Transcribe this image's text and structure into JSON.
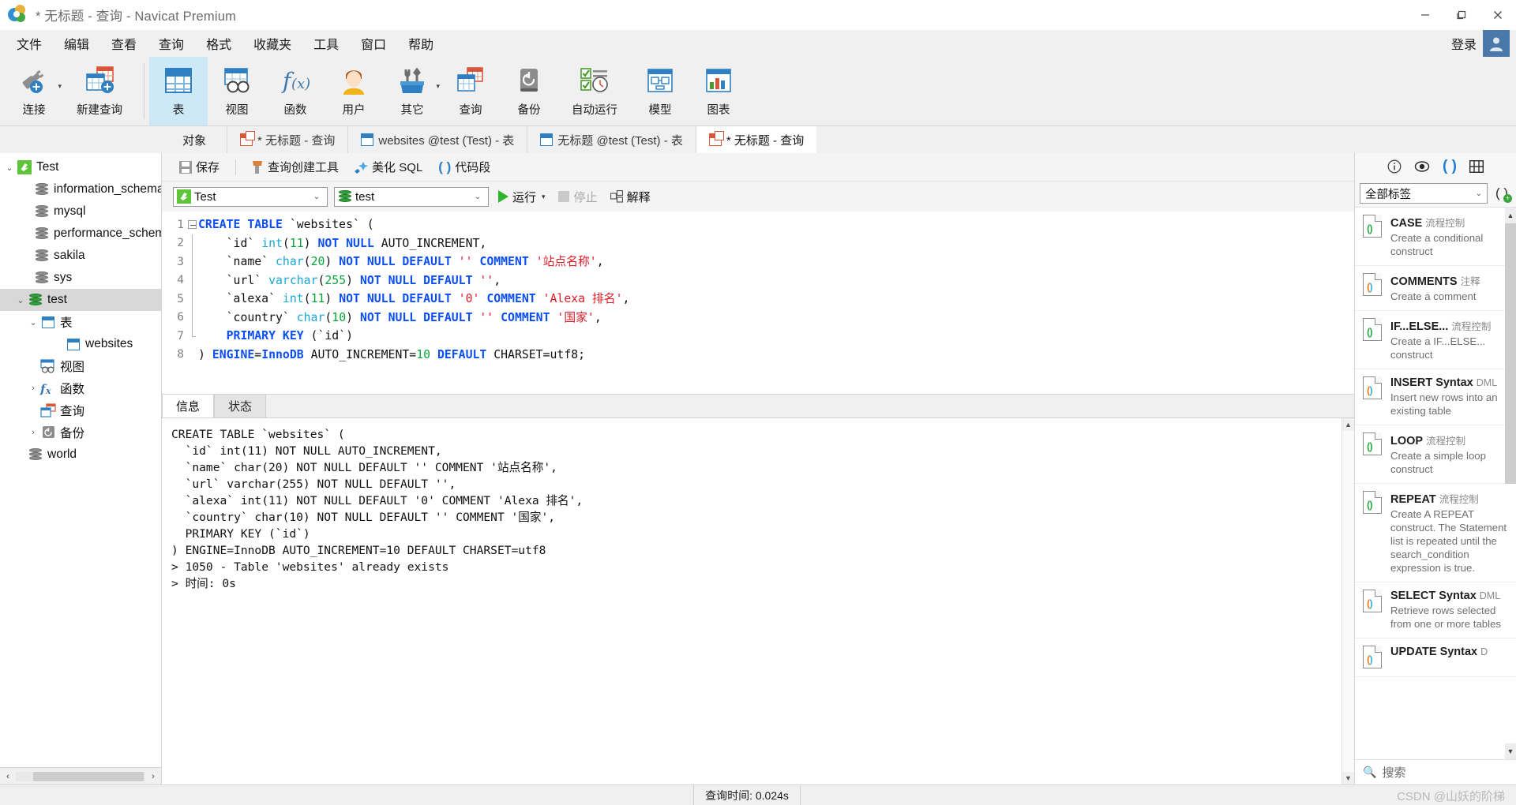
{
  "window": {
    "title": "* 无标题 - 查询 - Navicat Premium",
    "minimize": "–",
    "maximize": "❐",
    "close": "✕"
  },
  "menubar": {
    "items": [
      "文件",
      "编辑",
      "查看",
      "查询",
      "格式",
      "收藏夹",
      "工具",
      "窗口",
      "帮助"
    ],
    "login_label": "登录"
  },
  "ribbon": {
    "groups": [
      {
        "items": [
          {
            "label": "连接",
            "icon": "connection-plug-icon",
            "caret": true,
            "selected": false
          },
          {
            "label": "新建查询",
            "icon": "new-query-table-icon",
            "caret": false,
            "selected": false
          }
        ]
      },
      {
        "items": [
          {
            "label": "表",
            "icon": "table-icon",
            "caret": false,
            "selected": true
          },
          {
            "label": "视图",
            "icon": "view-glasses-icon",
            "caret": false,
            "selected": false
          },
          {
            "label": "函数",
            "icon": "function-fx-icon",
            "caret": false,
            "selected": false
          },
          {
            "label": "用户",
            "icon": "user-avatar-icon",
            "caret": false,
            "selected": false
          },
          {
            "label": "其它",
            "icon": "tools-toolbox-icon",
            "caret": true,
            "selected": false
          },
          {
            "label": "查询",
            "icon": "query-table-icon",
            "caret": false,
            "selected": false
          },
          {
            "label": "备份",
            "icon": "backup-drive-icon",
            "caret": false,
            "selected": false
          },
          {
            "label": "自动运行",
            "icon": "automation-clock-icon",
            "caret": false,
            "selected": false
          },
          {
            "label": "模型",
            "icon": "model-diagram-icon",
            "caret": false,
            "selected": false
          },
          {
            "label": "图表",
            "icon": "chart-icon",
            "caret": false,
            "selected": false
          }
        ]
      }
    ]
  },
  "tabstrip": {
    "object_label": "对象",
    "tabs": [
      {
        "label": "* 无标题 - 查询",
        "icon": "query-doc-icon",
        "active": false
      },
      {
        "label": "websites @test (Test) - 表",
        "icon": "table-icon",
        "active": false
      },
      {
        "label": "无标题 @test (Test) - 表",
        "icon": "table-edit-icon",
        "active": false
      },
      {
        "label": "* 无标题 - 查询",
        "icon": "query-doc-icon",
        "active": true
      }
    ]
  },
  "sidebar": {
    "nodes": [
      {
        "label": "Test",
        "depth": 0,
        "arrow": "down",
        "icon": "navicat-connection-icon",
        "selected": false
      },
      {
        "label": "information_schema",
        "depth": 1,
        "arrow": "none",
        "icon": "database-icon",
        "selected": false
      },
      {
        "label": "mysql",
        "depth": 1,
        "arrow": "none",
        "icon": "database-icon",
        "selected": false
      },
      {
        "label": "performance_schema",
        "depth": 1,
        "arrow": "none",
        "icon": "database-icon",
        "selected": false
      },
      {
        "label": "sakila",
        "depth": 1,
        "arrow": "none",
        "icon": "database-icon",
        "selected": false
      },
      {
        "label": "sys",
        "depth": 1,
        "arrow": "none",
        "icon": "database-icon",
        "selected": false
      },
      {
        "label": "test",
        "depth": 1,
        "arrow": "down",
        "icon": "database-green-icon",
        "selected": true
      },
      {
        "label": "表",
        "depth": 2,
        "arrow": "down",
        "icon": "table-icon",
        "selected": false
      },
      {
        "label": "websites",
        "depth": 3,
        "arrow": "none",
        "icon": "table-icon",
        "selected": false
      },
      {
        "label": "视图",
        "depth": 2,
        "arrow": "none",
        "icon": "view-glasses-icon",
        "selected": false
      },
      {
        "label": "函数",
        "depth": 2,
        "arrow": "right",
        "icon": "function-fx-icon",
        "selected": false
      },
      {
        "label": "查询",
        "depth": 2,
        "arrow": "none",
        "icon": "query-table-icon",
        "selected": false
      },
      {
        "label": "备份",
        "depth": 2,
        "arrow": "right",
        "icon": "backup-drive-icon",
        "selected": false
      },
      {
        "label": "world",
        "depth": 1,
        "arrow": "none",
        "icon": "database-icon",
        "selected": false
      }
    ],
    "scroll_left_arrow": "‹",
    "scroll_right_arrow": "›"
  },
  "query_toolbar": {
    "save": "保存",
    "query_builder": "查询创建工具",
    "beautify_sql": "美化 SQL",
    "code_snippet": "代码段",
    "connection_value": "Test",
    "database_value": "test",
    "run": "运行",
    "stop": "停止",
    "explain": "解释"
  },
  "editor": {
    "line_numbers": [
      "1",
      "2",
      "3",
      "4",
      "5",
      "6",
      "7",
      "8"
    ],
    "lines": [
      [
        {
          "t": "CREATE TABLE ",
          "c": "kw"
        },
        {
          "t": "`websites` (",
          "c": "pl"
        }
      ],
      [
        {
          "t": "    `id` ",
          "c": "pl"
        },
        {
          "t": "int",
          "c": "ty"
        },
        {
          "t": "(",
          "c": "pl"
        },
        {
          "t": "11",
          "c": "num"
        },
        {
          "t": ") ",
          "c": "pl"
        },
        {
          "t": "NOT NULL ",
          "c": "kw"
        },
        {
          "t": "AUTO_INCREMENT,",
          "c": "pl"
        }
      ],
      [
        {
          "t": "    `name` ",
          "c": "pl"
        },
        {
          "t": "char",
          "c": "ty"
        },
        {
          "t": "(",
          "c": "pl"
        },
        {
          "t": "20",
          "c": "num"
        },
        {
          "t": ") ",
          "c": "pl"
        },
        {
          "t": "NOT NULL DEFAULT ",
          "c": "kw"
        },
        {
          "t": "''",
          "c": "str"
        },
        {
          "t": " ",
          "c": "pl"
        },
        {
          "t": "COMMENT ",
          "c": "kw"
        },
        {
          "t": "'站点名称'",
          "c": "str"
        },
        {
          "t": ",",
          "c": "pl"
        }
      ],
      [
        {
          "t": "    `url` ",
          "c": "pl"
        },
        {
          "t": "varchar",
          "c": "ty"
        },
        {
          "t": "(",
          "c": "pl"
        },
        {
          "t": "255",
          "c": "num"
        },
        {
          "t": ") ",
          "c": "pl"
        },
        {
          "t": "NOT NULL DEFAULT ",
          "c": "kw"
        },
        {
          "t": "''",
          "c": "str"
        },
        {
          "t": ",",
          "c": "pl"
        }
      ],
      [
        {
          "t": "    `alexa` ",
          "c": "pl"
        },
        {
          "t": "int",
          "c": "ty"
        },
        {
          "t": "(",
          "c": "pl"
        },
        {
          "t": "11",
          "c": "num"
        },
        {
          "t": ") ",
          "c": "pl"
        },
        {
          "t": "NOT NULL DEFAULT ",
          "c": "kw"
        },
        {
          "t": "'0'",
          "c": "str"
        },
        {
          "t": " ",
          "c": "pl"
        },
        {
          "t": "COMMENT ",
          "c": "kw"
        },
        {
          "t": "'Alexa 排名'",
          "c": "str"
        },
        {
          "t": ",",
          "c": "pl"
        }
      ],
      [
        {
          "t": "    `country` ",
          "c": "pl"
        },
        {
          "t": "char",
          "c": "ty"
        },
        {
          "t": "(",
          "c": "pl"
        },
        {
          "t": "10",
          "c": "num"
        },
        {
          "t": ") ",
          "c": "pl"
        },
        {
          "t": "NOT NULL DEFAULT ",
          "c": "kw"
        },
        {
          "t": "''",
          "c": "str"
        },
        {
          "t": " ",
          "c": "pl"
        },
        {
          "t": "COMMENT ",
          "c": "kw"
        },
        {
          "t": "'国家'",
          "c": "str"
        },
        {
          "t": ",",
          "c": "pl"
        }
      ],
      [
        {
          "t": "    ",
          "c": "pl"
        },
        {
          "t": "PRIMARY KEY ",
          "c": "kw"
        },
        {
          "t": "(`id`)",
          "c": "pl"
        }
      ],
      [
        {
          "t": ") ",
          "c": "pl"
        },
        {
          "t": "ENGINE",
          "c": "kw"
        },
        {
          "t": "=",
          "c": "pl"
        },
        {
          "t": "InnoDB",
          "c": "kw"
        },
        {
          "t": " AUTO_INCREMENT=",
          "c": "pl"
        },
        {
          "t": "10",
          "c": "num"
        },
        {
          "t": " ",
          "c": "pl"
        },
        {
          "t": "DEFAULT ",
          "c": "kw"
        },
        {
          "t": "CHARSET=utf8;",
          "c": "pl"
        }
      ]
    ]
  },
  "results": {
    "tabs": [
      {
        "label": "信息",
        "active": true
      },
      {
        "label": "状态",
        "active": false
      }
    ],
    "output": "CREATE TABLE `websites` (\n  `id` int(11) NOT NULL AUTO_INCREMENT,\n  `name` char(20) NOT NULL DEFAULT '' COMMENT '站点名称',\n  `url` varchar(255) NOT NULL DEFAULT '',\n  `alexa` int(11) NOT NULL DEFAULT '0' COMMENT 'Alexa 排名',\n  `country` char(10) NOT NULL DEFAULT '' COMMENT '国家',\n  PRIMARY KEY (`id`)\n) ENGINE=InnoDB AUTO_INCREMENT=10 DEFAULT CHARSET=utf8\n> 1050 - Table 'websites' already exists\n> 时间: 0s"
  },
  "right_panel": {
    "icons": [
      "info-icon",
      "eye-icon",
      "parentheses-icon",
      "grid-icon"
    ],
    "filter_value": "全部标签",
    "add_snippet_icon": "add-snippet-icon",
    "snippets": [
      {
        "title": "CASE",
        "tag": "流程控制",
        "desc": "Create a conditional construct",
        "color": "green"
      },
      {
        "title": "COMMENTS",
        "tag": "注释",
        "desc": "Create a comment",
        "color": "multi"
      },
      {
        "title": "IF...ELSE...",
        "tag": "流程控制",
        "desc": "Create a IF...ELSE... construct",
        "color": "green"
      },
      {
        "title": "INSERT Syntax",
        "tag": "DML",
        "desc": "Insert new rows into an existing table",
        "color": "multi"
      },
      {
        "title": "LOOP",
        "tag": "流程控制",
        "desc": "Create a simple loop construct",
        "color": "green"
      },
      {
        "title": "REPEAT",
        "tag": "流程控制",
        "desc": "Create A REPEAT construct. The Statement list is repeated until the search_condition expression is true.",
        "color": "green"
      },
      {
        "title": "SELECT Syntax",
        "tag": "DML",
        "desc": "Retrieve rows selected from one or more tables",
        "color": "multi"
      },
      {
        "title": "UPDATE Syntax",
        "tag": "D",
        "desc": "",
        "color": "multi"
      }
    ],
    "search_placeholder": "搜索"
  },
  "statusbar": {
    "query_time": "查询时间: 0.024s",
    "watermark": "CSDN @山妖的阶梯"
  },
  "colors": {
    "accent_blue": "#2f80c2",
    "selection_blue": "#cde8f7",
    "green": "#2db52d",
    "keyword": "#0c4ef5",
    "type": "#1ba7d4",
    "number": "#0aa33a",
    "string": "#e01b24"
  }
}
